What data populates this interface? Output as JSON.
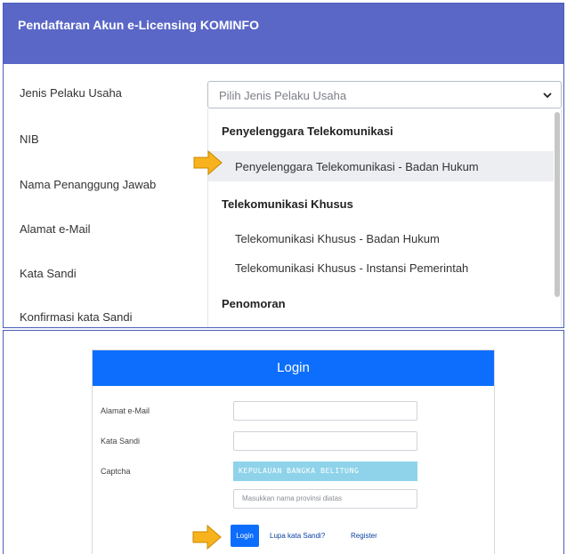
{
  "registration": {
    "header_title": "Pendaftaran Akun e-Licensing KOMINFO",
    "fields": {
      "jenis_pelaku_usaha": "Jenis Pelaku Usaha",
      "nib": "NIB",
      "nama_penanggung_jawab": "Nama Penanggung Jawab",
      "alamat_email": "Alamat e-Mail",
      "kata_sandi": "Kata Sandi",
      "konfirmasi_kata_sandi": "Konfirmasi kata Sandi"
    },
    "select_placeholder": "Pilih Jenis Pelaku Usaha",
    "dropdown": {
      "group1": "Penyelenggara Telekomunikasi",
      "option1": "Penyelenggara Telekomunikasi - Badan Hukum",
      "group2": "Telekomunikasi Khusus",
      "option2": "Telekomunikasi Khusus - Badan Hukum",
      "option3": "Telekomunikasi Khusus - Instansi Pemerintah",
      "group3": "Penomoran"
    }
  },
  "login": {
    "title": "Login",
    "email_label": "Alamat e-Mail",
    "password_label": "Kata Sandi",
    "captcha_label": "Captcha",
    "captcha_text": "KEPULAUAN BANGKA BELITUNG",
    "captcha_placeholder": "Masukkan nama provinsi diatas",
    "login_button": "Login",
    "forgot_link": "Lupa kata Sandi?",
    "register_link": "Register"
  },
  "colors": {
    "header_bg": "#5a67c7",
    "login_header_bg": "#0d6efd",
    "arrow_fill": "#f7b21d",
    "captcha_bg": "#8fd3ea"
  },
  "icons": {
    "select_chevron": "chevron-down-icon",
    "pointer_arrow": "arrow-right-icon"
  }
}
